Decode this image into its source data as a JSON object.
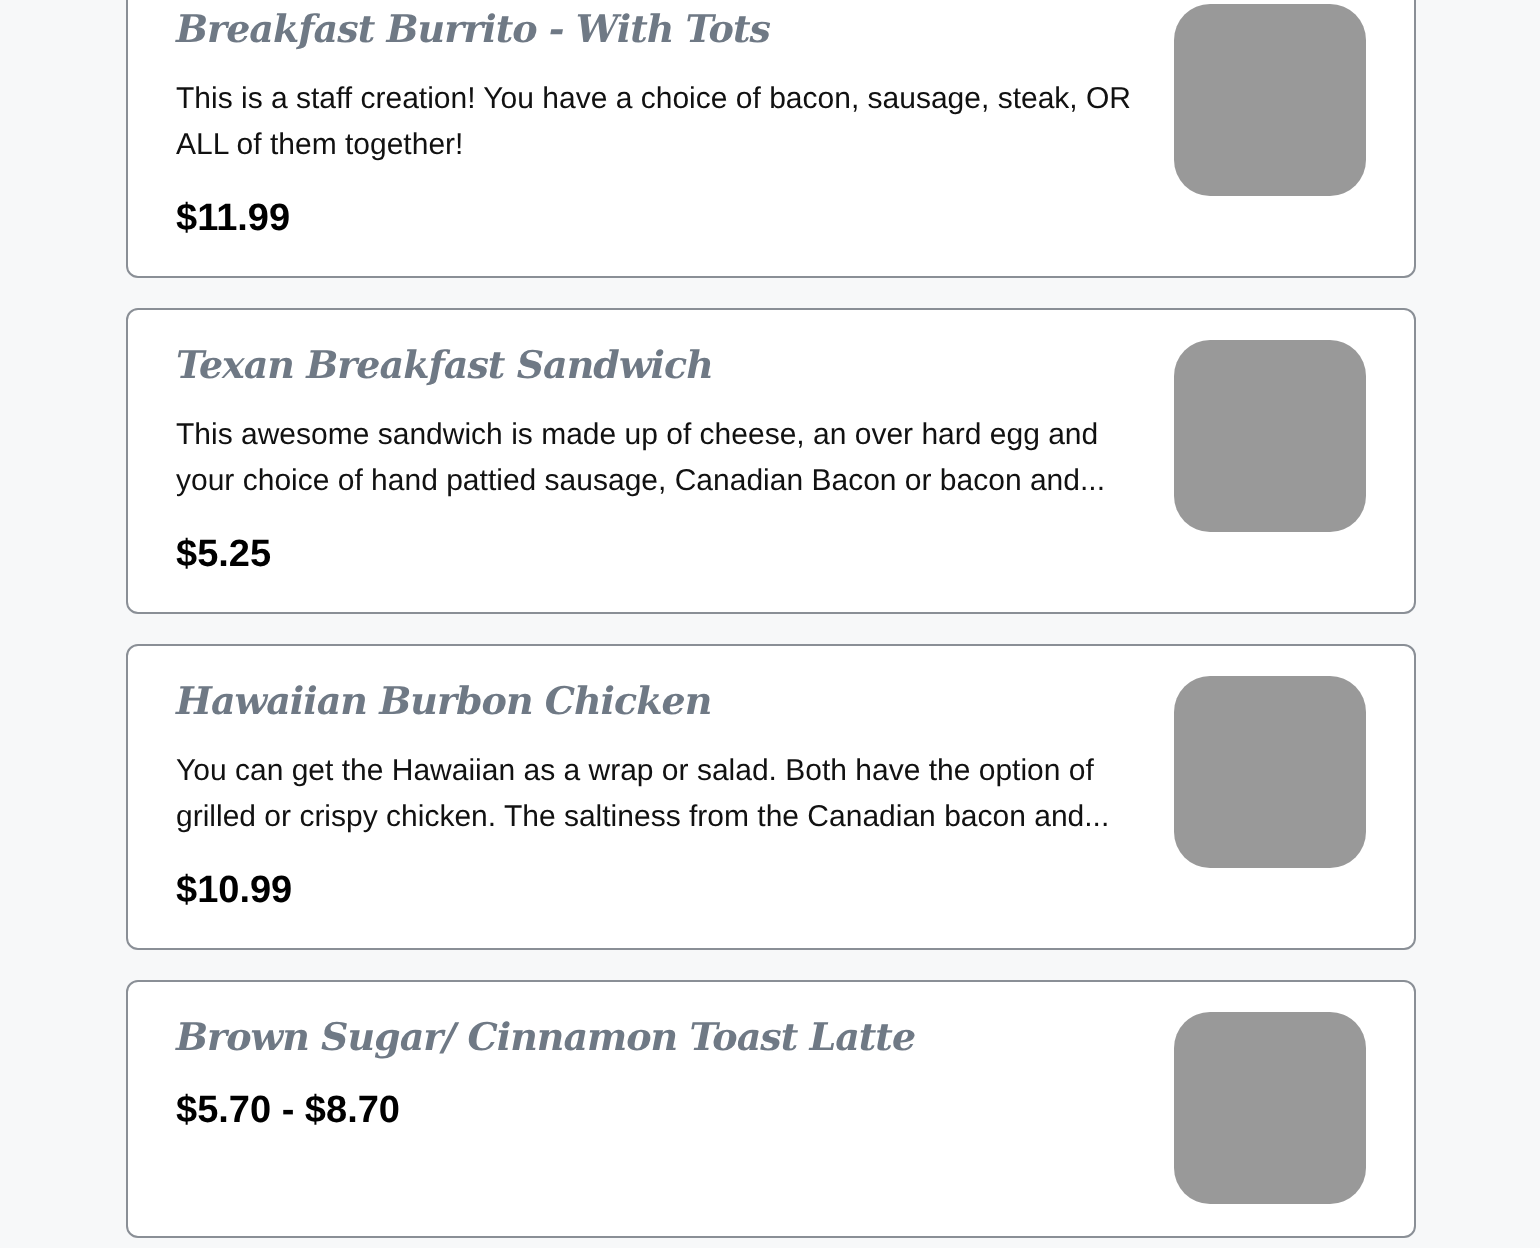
{
  "menu_items": [
    {
      "name": "Breakfast Burrito - With Tots",
      "description": "This is a staff creation! You have a choice of bacon, sausage, steak, OR ALL of them together!",
      "price": "$11.99"
    },
    {
      "name": "Texan Breakfast Sandwich",
      "description": "This awesome sandwich is made up of cheese, an over hard egg and your choice of hand pattied sausage, Canadian Bacon or bacon and...",
      "price": "$5.25"
    },
    {
      "name": "Hawaiian Burbon Chicken",
      "description": "You can get the Hawaiian as a wrap or salad. Both have the option of grilled or crispy chicken. The saltiness from the Canadian bacon and...",
      "price": "$10.99"
    },
    {
      "name": "Brown Sugar/ Cinnamon Toast Latte",
      "price": "$5.70 - $8.70"
    }
  ]
}
